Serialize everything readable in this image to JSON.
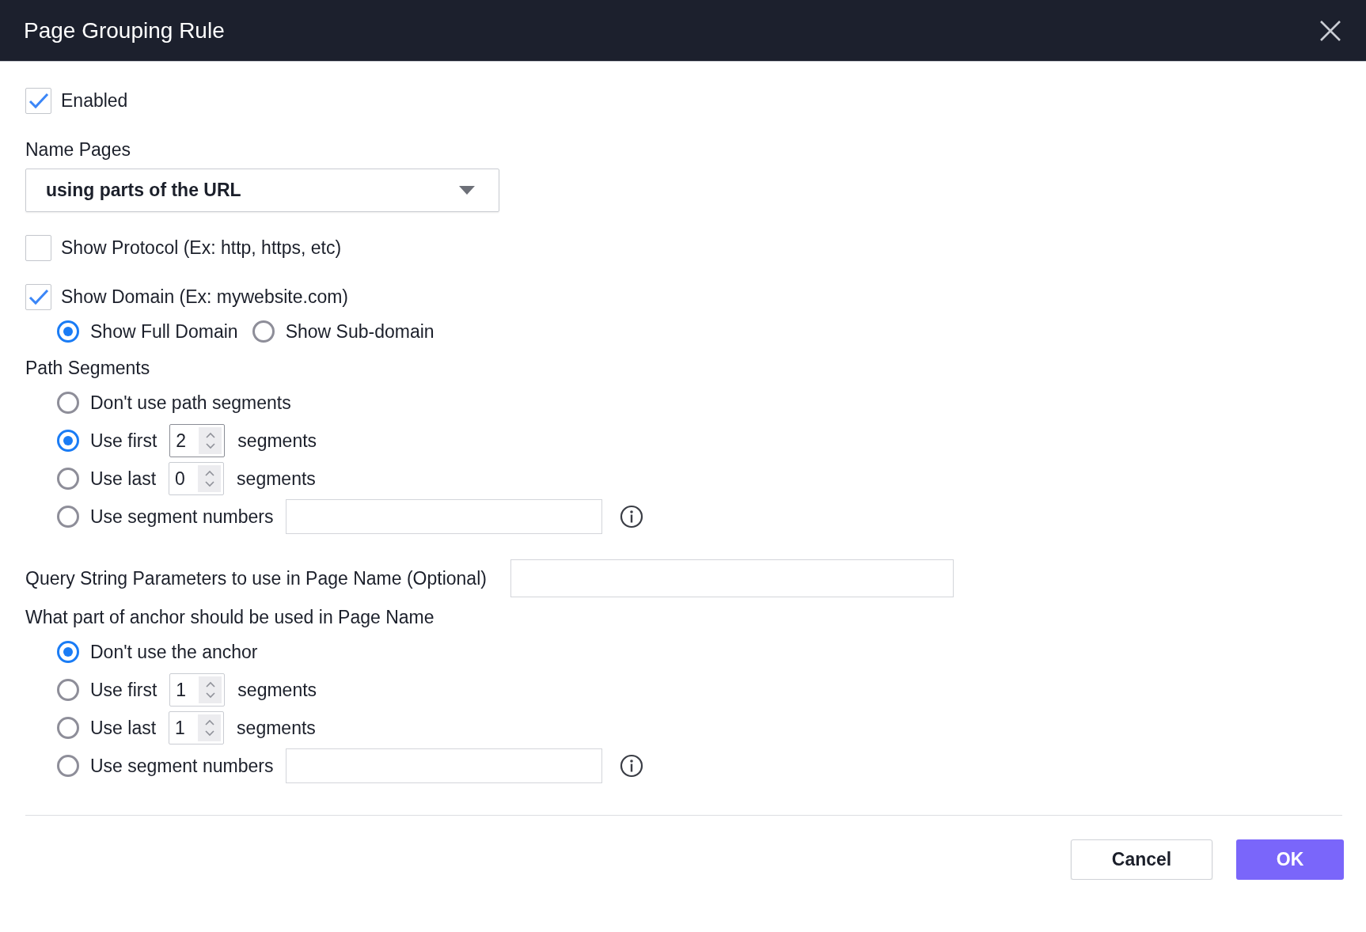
{
  "window": {
    "title": "Page Grouping Rule"
  },
  "enabled": {
    "label": "Enabled",
    "checked": true
  },
  "name_pages": {
    "label": "Name Pages",
    "value": "using parts of the URL"
  },
  "show_protocol": {
    "label": "Show Protocol (Ex: http, https, etc)",
    "checked": false
  },
  "show_domain": {
    "label": "Show Domain (Ex: mywebsite.com)",
    "checked": true,
    "options": [
      {
        "label": "Show Full Domain",
        "selected": true
      },
      {
        "label": "Show Sub-domain",
        "selected": false
      }
    ]
  },
  "path_segments": {
    "label": "Path Segments",
    "options": [
      {
        "kind": "plain",
        "label": "Don't use path segments",
        "selected": false
      },
      {
        "kind": "count",
        "label": "Use first",
        "value": "2",
        "suffix": "segments",
        "selected": true
      },
      {
        "kind": "count",
        "label": "Use last",
        "value": "0",
        "suffix": "segments",
        "selected": false
      },
      {
        "kind": "list",
        "label": "Use segment numbers",
        "selected": false
      }
    ]
  },
  "query_string": {
    "label": "Query String Parameters to use in Page Name (Optional)"
  },
  "anchor": {
    "label": "What part of anchor should be used in Page Name",
    "options": [
      {
        "kind": "plain",
        "label": "Don't use the anchor",
        "selected": true
      },
      {
        "kind": "count",
        "label": "Use first",
        "value": "1",
        "suffix": "segments",
        "selected": false
      },
      {
        "kind": "count",
        "label": "Use last",
        "value": "1",
        "suffix": "segments",
        "selected": false
      },
      {
        "kind": "list",
        "label": "Use segment numbers",
        "selected": false
      }
    ]
  },
  "buttons": [
    {
      "label": "Cancel",
      "kind": "secondary"
    },
    {
      "label": "OK",
      "kind": "primary"
    }
  ]
}
